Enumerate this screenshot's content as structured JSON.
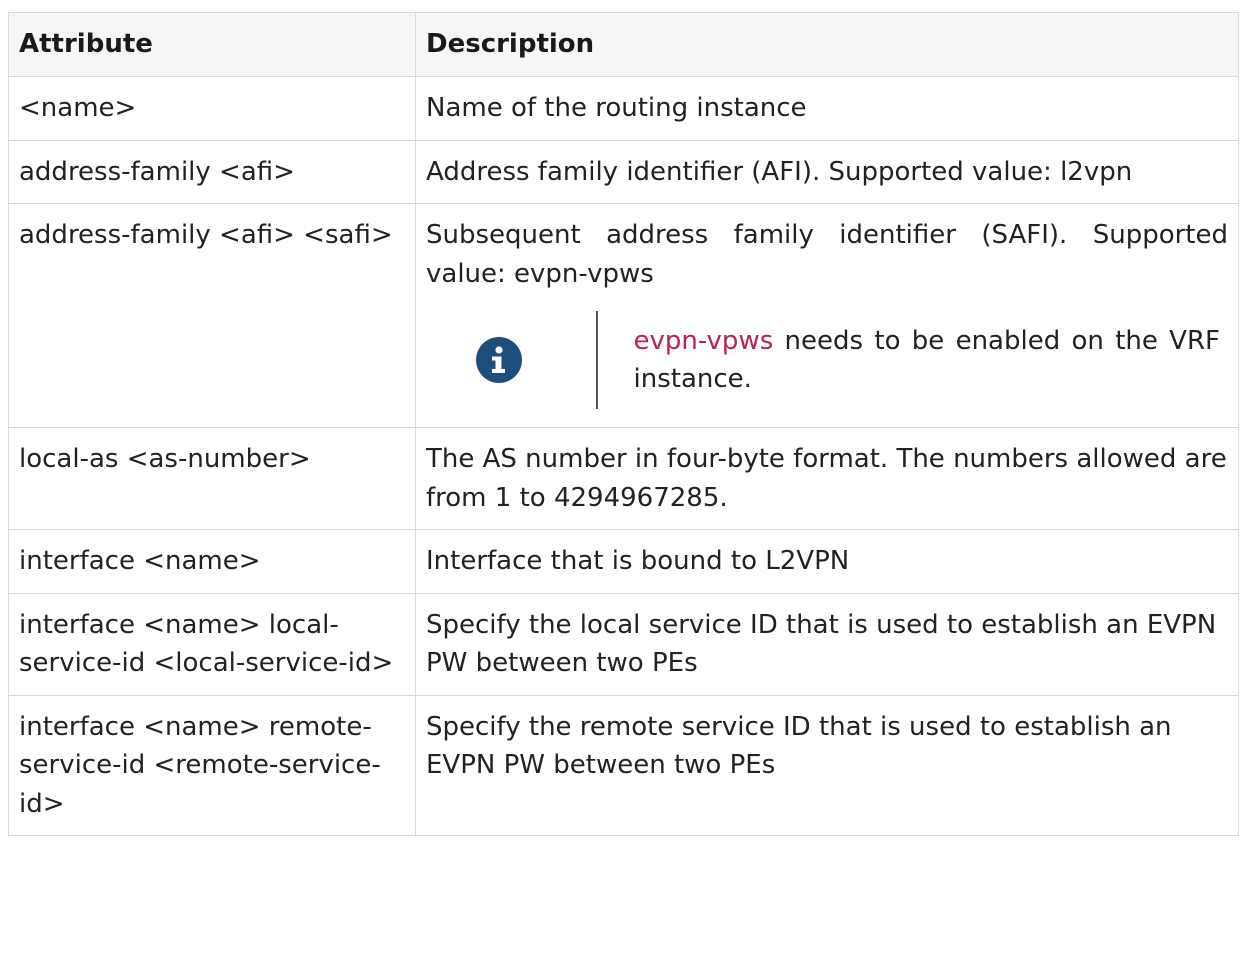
{
  "headers": {
    "attribute": "Attribute",
    "description": "Description"
  },
  "rows": [
    {
      "attribute": "<name>",
      "description": "Name of the routing instance"
    },
    {
      "attribute": "address-family <afi>",
      "description": "Address family identifier (AFI). Supported value: l2vpn"
    },
    {
      "attribute": "address-family <afi> <safi>",
      "description": "Subsequent address family identifier (SAFI). Supported value: evpn-vpws",
      "note": {
        "icon": "info-icon",
        "keyword": "evpn-vpws",
        "text": " needs to be enabled on the VRF instance."
      }
    },
    {
      "attribute": "local-as <as-number>",
      "description": "The AS number in four-byte format. The numbers allowed are from 1 to 4294967285."
    },
    {
      "attribute": "interface <name>",
      "description": "Interface that is bound to L2VPN"
    },
    {
      "attribute": "interface <name> local-service-id <local-service-id>",
      "description": "Specify the local service ID that is used to establish an EVPN PW between two PEs"
    },
    {
      "attribute": "interface <name> remote-service-id <remote-service-id>",
      "description": "Specify the remote service ID that is used to establish an EVPN PW between two PEs"
    }
  ],
  "colors": {
    "info_icon_bg": "#1f4e7d",
    "keyword": "#b7254f",
    "border": "#d9d9d9",
    "header_bg": "#f6f6f6"
  }
}
